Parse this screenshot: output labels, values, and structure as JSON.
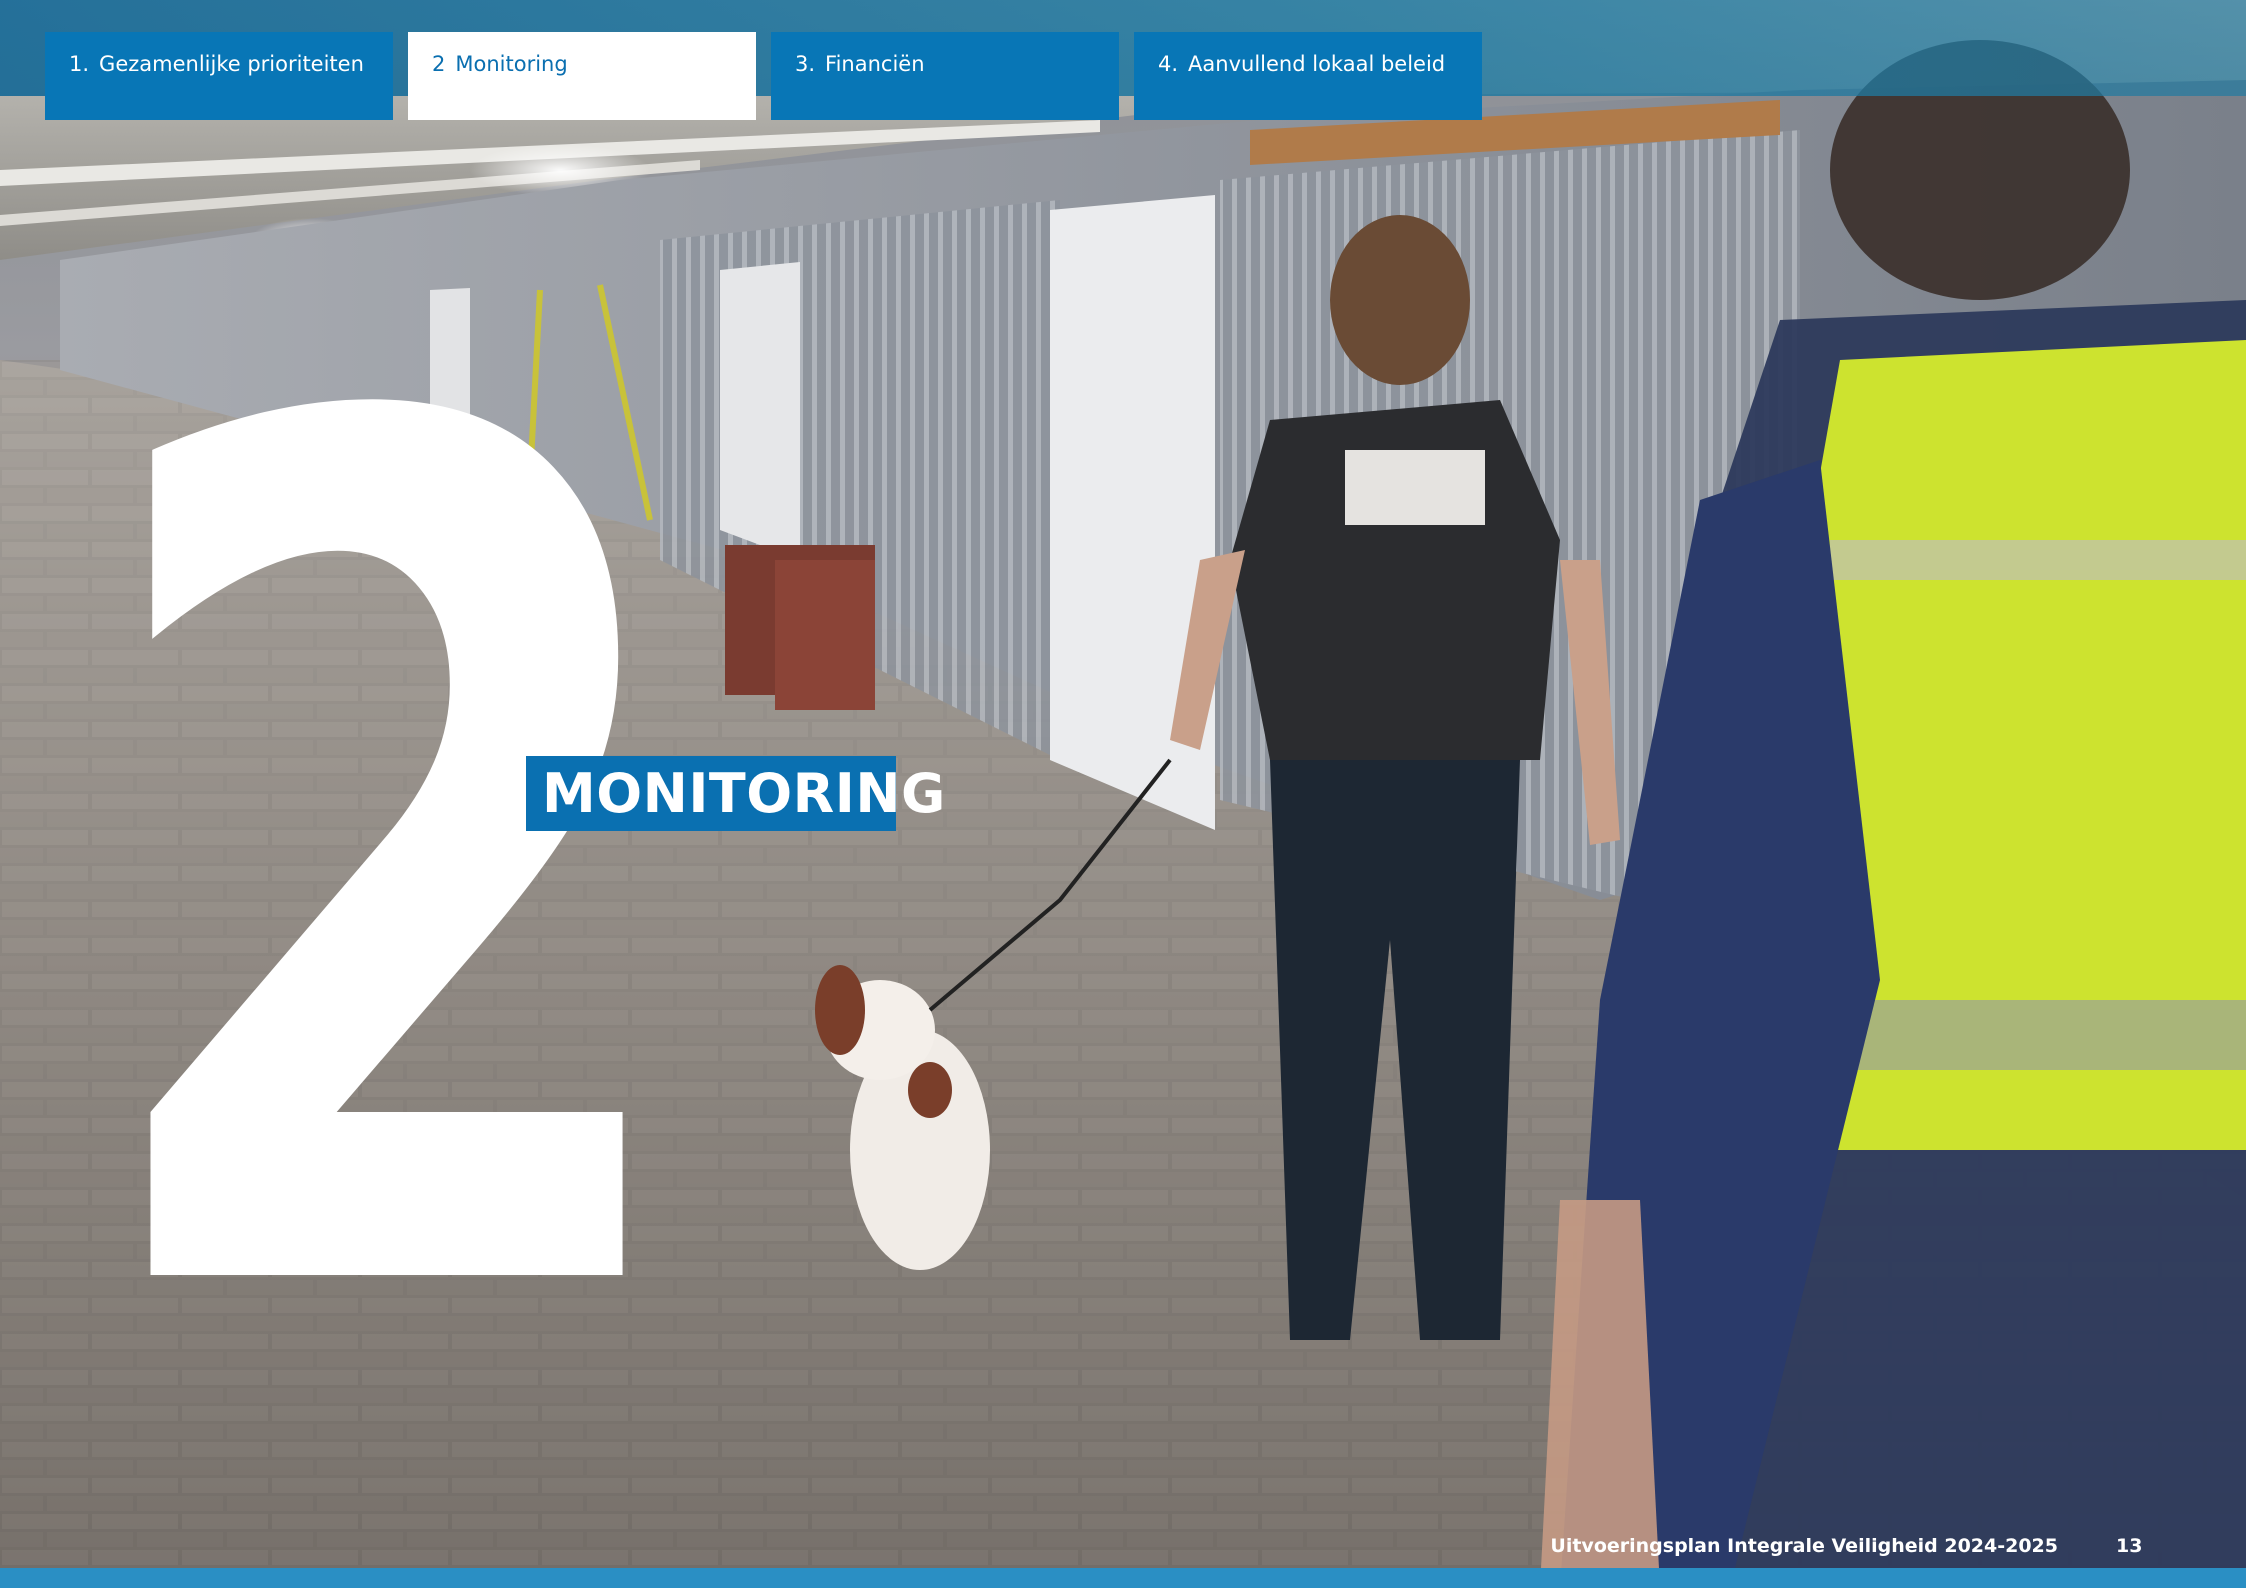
{
  "nav": {
    "tabs": [
      {
        "number": "1.",
        "label": "Gezamenlijke prioriteiten",
        "active": false
      },
      {
        "number": "2",
        "label": "Monitoring",
        "active": true
      },
      {
        "number": "3.",
        "label": "Financiën",
        "active": false
      },
      {
        "number": "4.",
        "label": "Aanvullend lokaal beleid",
        "active": false
      }
    ]
  },
  "chapter": {
    "number": "2",
    "title": "MONITORING"
  },
  "footer": {
    "document_title": "Uitvoeringsplan Integrale Veiligheid 2024-2025",
    "page_number": "13"
  },
  "colors": {
    "brand_blue": "#0876b6",
    "tab_active_bg": "#ffffff",
    "vest_yellow": "#d6ec2c"
  },
  "photo": {
    "description_icon": "garage-corridor-photo"
  }
}
